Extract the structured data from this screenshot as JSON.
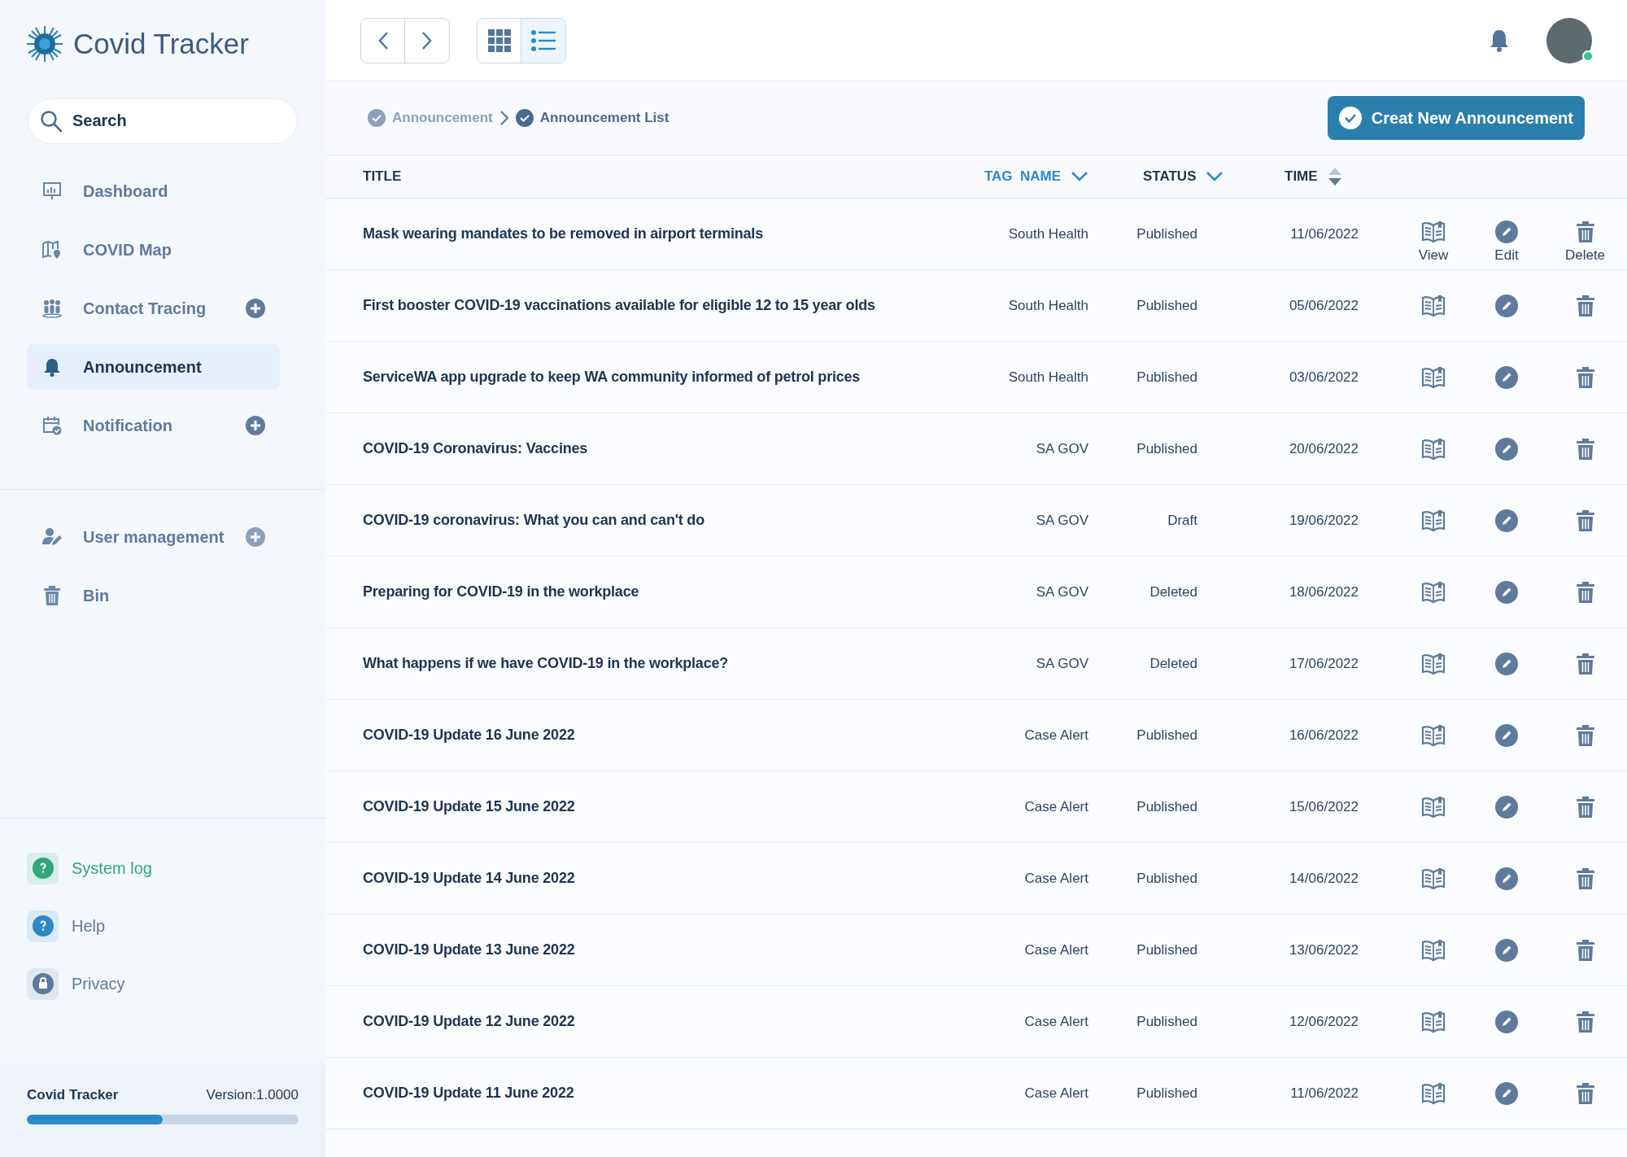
{
  "app": {
    "title": "Covid Tracker"
  },
  "search": {
    "placeholder": "Search"
  },
  "nav": [
    {
      "label": "Dashboard",
      "selected": false,
      "addable": false
    },
    {
      "label": "COVID Map",
      "selected": false,
      "addable": false
    },
    {
      "label": "Contact Tracing",
      "selected": false,
      "addable": true
    },
    {
      "label": "Announcement",
      "selected": true,
      "addable": false
    },
    {
      "label": "Notification",
      "selected": false,
      "addable": true
    }
  ],
  "nav_secondary": [
    {
      "label": "User management",
      "selected": false,
      "addable": true
    },
    {
      "label": "Bin",
      "selected": false,
      "addable": false
    }
  ],
  "support_links": [
    {
      "label": "System log",
      "color": "#2fa779"
    },
    {
      "label": "Help",
      "color": "#2b8ac6"
    },
    {
      "label": "Privacy",
      "color": "#5f7a99"
    }
  ],
  "footer": {
    "name": "Covid Tracker",
    "version": "Version:1.0000",
    "level": 0.5
  },
  "view_toggle": [
    {
      "kind": "grid",
      "selected": false
    },
    {
      "kind": "list",
      "selected": true
    }
  ],
  "user": {
    "online": true
  },
  "breadcrumb": [
    "Announcement",
    "Announcement List"
  ],
  "create_button": "Creat New Announcement",
  "table": {
    "columns": [
      {
        "label": "TITLE",
        "kind": "plain",
        "selected": false
      },
      {
        "label": "TAG  NAME",
        "kind": "dropdown",
        "selected": true
      },
      {
        "label": "STATUS",
        "kind": "dropdown",
        "selected": false
      },
      {
        "label": "TIME",
        "kind": "sort",
        "selected": false
      }
    ],
    "action_labels": [
      "View",
      "Edit",
      "Delete"
    ],
    "rows": [
      {
        "title": "Mask wearing mandates to be removed in airport terminals",
        "tag": "South Health",
        "status": "Published",
        "time": "11/06/2022"
      },
      {
        "title": "First booster COVID-19 vaccinations available for eligible 12 to 15 year olds",
        "tag": "South Health",
        "status": "Published",
        "time": "05/06/2022"
      },
      {
        "title": "ServiceWA app upgrade to keep WA community informed of petrol prices",
        "tag": "South Health",
        "status": "Published",
        "time": "03/06/2022"
      },
      {
        "title": "COVID-19 Coronavirus: Vaccines",
        "tag": "SA GOV",
        "status": "Published",
        "time": "20/06/2022"
      },
      {
        "title": "COVID-19 coronavirus: What you can and can't do",
        "tag": "SA GOV",
        "status": "Draft",
        "time": "19/06/2022"
      },
      {
        "title": "Preparing for COVID-19 in the workplace",
        "tag": "SA GOV",
        "status": "Deleted",
        "time": "18/06/2022"
      },
      {
        "title": "What happens if we have COVID-19 in the workplace?",
        "tag": "SA GOV",
        "status": "Deleted",
        "time": "17/06/2022"
      },
      {
        "title": "COVID-19 Update 16 June 2022",
        "tag": "Case Alert",
        "status": "Published",
        "time": "16/06/2022"
      },
      {
        "title": "COVID-19 Update 15 June 2022",
        "tag": "Case Alert",
        "status": "Published",
        "time": "15/06/2022"
      },
      {
        "title": "COVID-19 Update 14 June 2022",
        "tag": "Case Alert",
        "status": "Published",
        "time": "14/06/2022"
      },
      {
        "title": "COVID-19 Update 13 June 2022",
        "tag": "Case Alert",
        "status": "Published",
        "time": "13/06/2022"
      },
      {
        "title": "COVID-19 Update 12 June 2022",
        "tag": "Case Alert",
        "status": "Published",
        "time": "12/06/2022"
      },
      {
        "title": "COVID-19 Update 11 June 2022",
        "tag": "Case Alert",
        "status": "Published",
        "time": "11/06/2022"
      }
    ]
  }
}
